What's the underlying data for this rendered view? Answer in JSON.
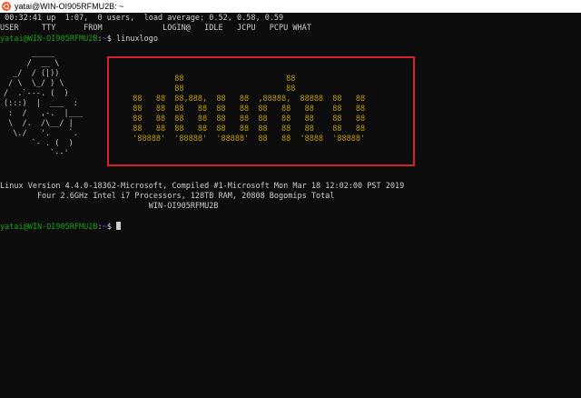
{
  "window": {
    "title": "yatai@WIN-OI905RFMU2B: ~",
    "icon": "ubuntu-icon",
    "accent": "#e95420"
  },
  "terminal": {
    "uptime_line": " 00:32:41 up  1:07,  0 users,  load average: 0.52, 0.58, 0.59",
    "header_line": "USER     TTY      FROM             LOGIN@   IDLE   JCPU   PCPU WHAT",
    "prompt_user": "yatai@WIN-OI905RFMU2B",
    "prompt_sep": ":",
    "prompt_dir": "~",
    "prompt_symbol": "$",
    "command": "linuxlogo",
    "penguin_art": [
      "      _____",
      "     /  __ \\",
      "  _/  / (|))",
      " / \\  \\_/ ) \\",
      "/  .`---. (  )",
      "(:::)  |  ___  :",
      " :  /   ,-.  |___",
      " \\  /.  /\\__/ |",
      "  \\./   '.    `.",
      "      `- . (  )",
      "          `--'"
    ],
    "logo_art": [
      "           88                      88",
      "           88                      88",
      "  88   88  88,888,  88   88  ,88888,  88888  88   88",
      "  88   88  88   88  88   88  88   88   88    88   88",
      "  88   88  88   88  88   88  88   88   88    88   88",
      "  88   88  88   88  88   88  88   88   88    88   88",
      "  '88888'  '88888'  '88888'  88   88  '8888  '88888'"
    ],
    "system_info": [
      "Linux Version 4.4.0-18362-Microsoft, Compiled #1-Microsoft Mon Mar 18 12:02:00 PST 2019",
      "        Four 2.6GHz Intel i7 Processors, 128TB RAM, 20808 Bogomips Total",
      "                                WIN-OI905RFMU2B"
    ],
    "colors": {
      "background": "#0c0c0c",
      "text": "#cccccc",
      "prompt": "#13a10e",
      "logo": "#c19c00",
      "highlight": "#d8202a"
    }
  }
}
